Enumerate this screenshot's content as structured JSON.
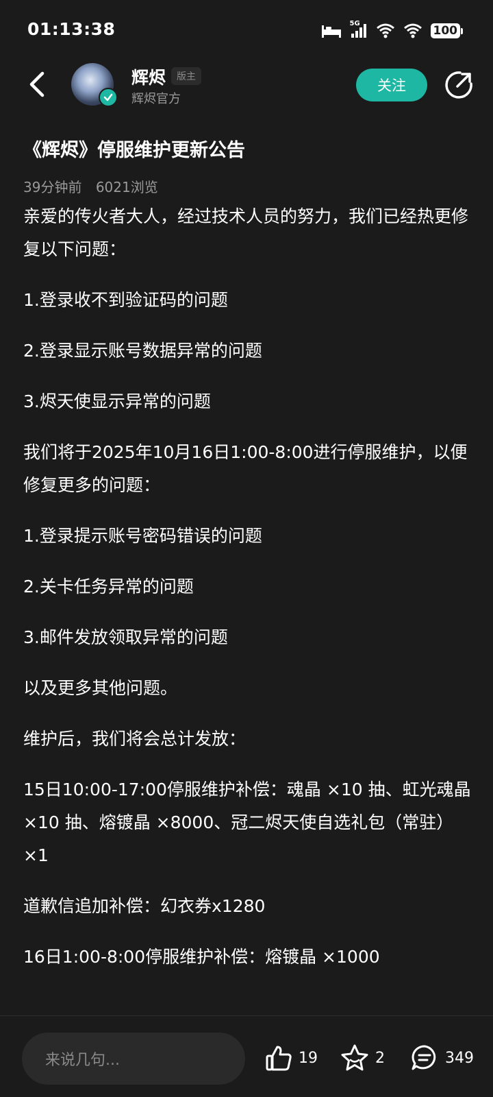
{
  "status_bar": {
    "time": "01:13:38",
    "network": "5G",
    "battery": "100",
    "icons": [
      "bed-icon",
      "signal-icon",
      "wifi-icon",
      "wifi-icon",
      "battery-icon"
    ]
  },
  "header": {
    "author_name": "辉烬",
    "author_badge": "版主",
    "author_sub": "辉烬官方",
    "follow_label": "关注",
    "icons": [
      "back-icon",
      "verified-icon",
      "share-icon"
    ]
  },
  "post": {
    "title": "《辉烬》停服维护更新公告",
    "time": "39分钟前",
    "views": "6021浏览",
    "paragraphs": [
      "亲爱的传火者大人，经过技术人员的努力，我们已经热更修复以下问题：",
      "1.登录收不到验证码的问题",
      "2.登录显示账号数据异常的问题",
      "3.烬天使显示异常的问题",
      "我们将于2025年10月16日1:00-8:00进行停服维护，以便修复更多的问题：",
      "1.登录提示账号密码错误的问题",
      "2.关卡任务异常的问题",
      "3.邮件发放领取异常的问题",
      "以及更多其他问题。",
      "维护后，我们将会总计发放：",
      "15日10:00-17:00停服维护补偿：魂晶 ×10 抽、虹光魂晶 ×10 抽、熔镀晶 ×8000、冠二烬天使自选礼包（常驻）×1",
      "道歉信追加补偿：幻衣券x1280",
      "16日1:00-8:00停服维护补偿：熔镀晶 ×1000"
    ]
  },
  "bottom_bar": {
    "comment_placeholder": "来说几句...",
    "likes": "19",
    "favorites": "2",
    "comments": "349",
    "icons": [
      "thumbs-up-icon",
      "star-icon",
      "comment-icon"
    ]
  },
  "colors": {
    "background": "#1b1b1b",
    "accent": "#1db7a3",
    "secondary_text": "#9a9a9a"
  }
}
